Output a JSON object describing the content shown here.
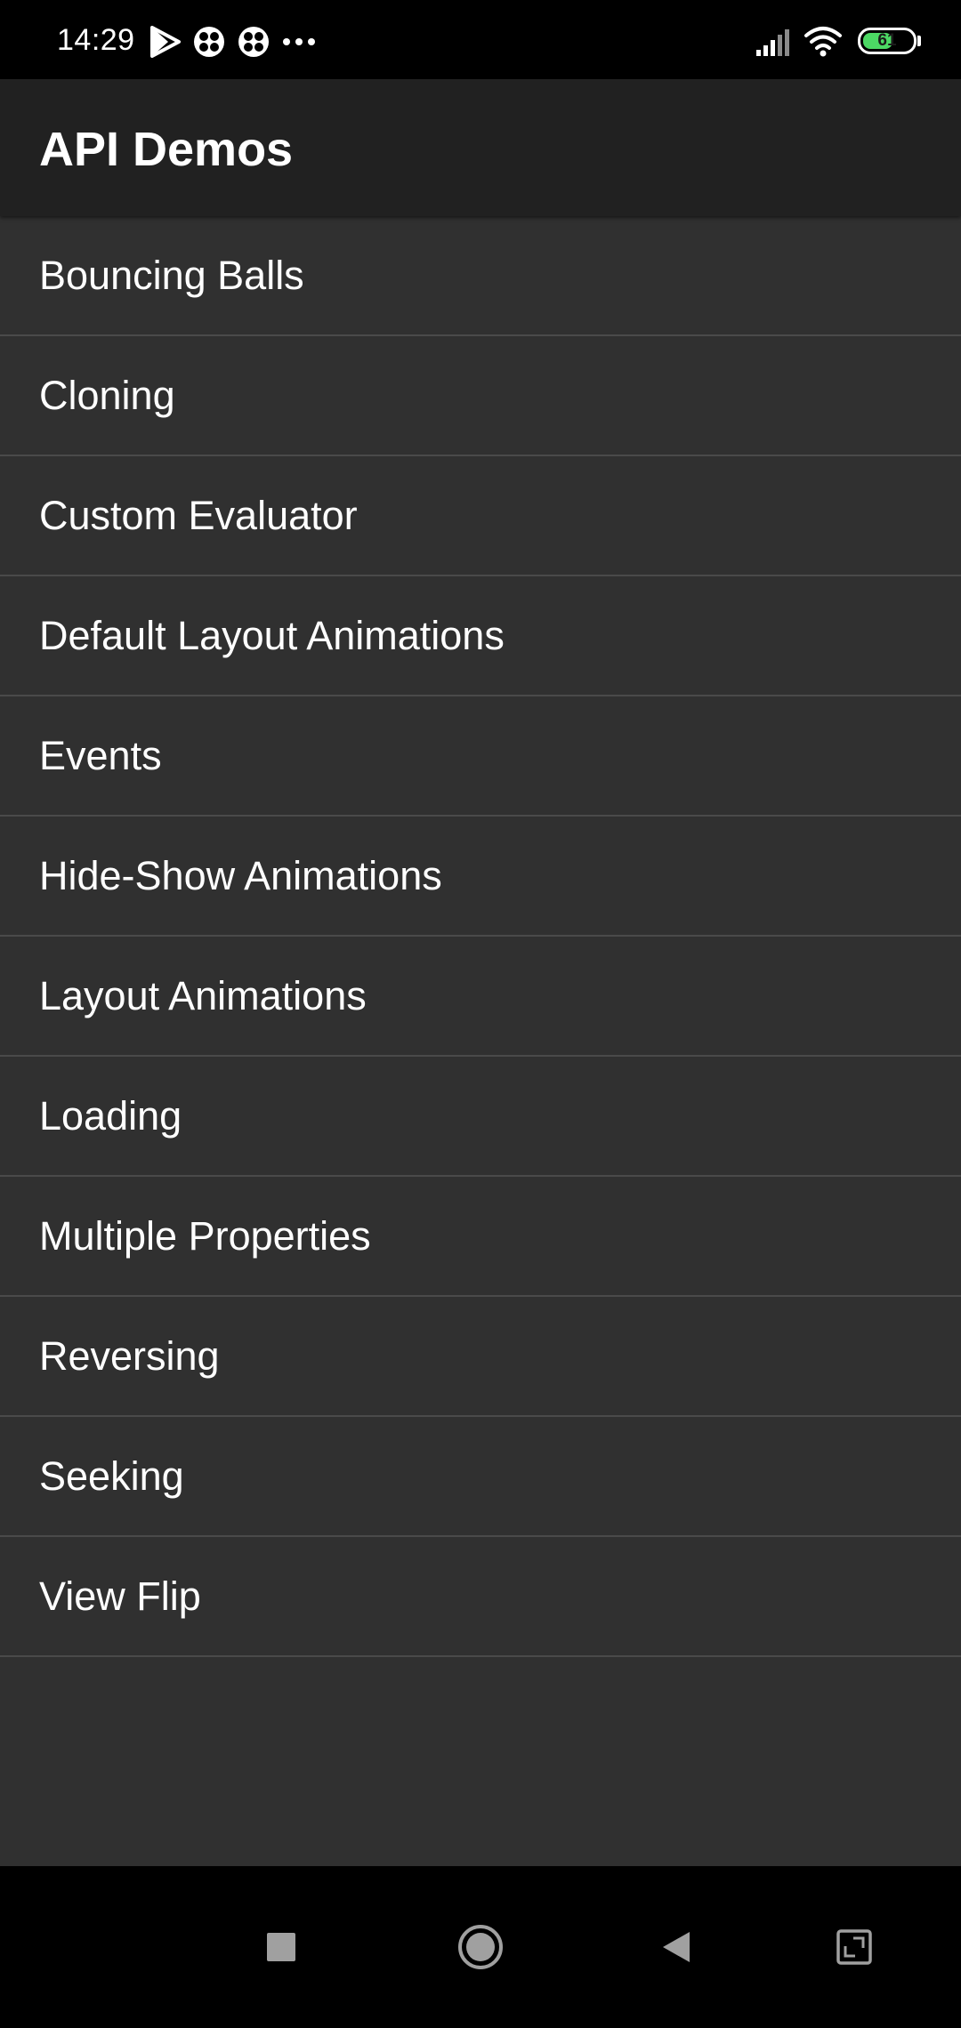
{
  "status_bar": {
    "time": "14:29",
    "notification_icons": [
      "play-store-icon",
      "app-icon",
      "app-icon",
      "more-dots-icon"
    ],
    "signal_icon": "cellular-signal-icon",
    "wifi_icon": "wifi-icon",
    "battery_level": "61",
    "battery_percent": 61,
    "battery_color": "#4cd964"
  },
  "app_bar": {
    "title": "API Demos",
    "background": "#212121"
  },
  "list": {
    "background": "#303030",
    "items": [
      {
        "label": "Bouncing Balls"
      },
      {
        "label": "Cloning"
      },
      {
        "label": "Custom Evaluator"
      },
      {
        "label": "Default Layout Animations"
      },
      {
        "label": "Events"
      },
      {
        "label": "Hide-Show Animations"
      },
      {
        "label": "Layout Animations"
      },
      {
        "label": "Loading"
      },
      {
        "label": "Multiple Properties"
      },
      {
        "label": "Reversing"
      },
      {
        "label": "Seeking"
      },
      {
        "label": "View Flip"
      }
    ]
  },
  "nav_bar": {
    "buttons": [
      "recents-square-icon",
      "home-circle-icon",
      "back-triangle-icon",
      "screenshot-frame-icon"
    ]
  }
}
